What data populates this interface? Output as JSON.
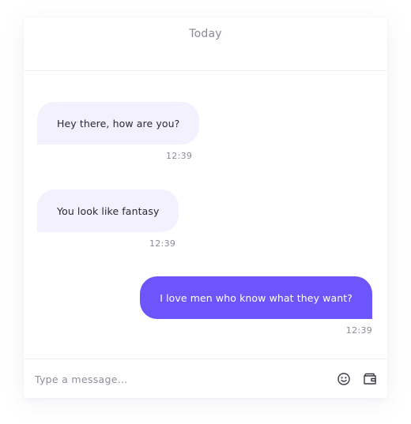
{
  "header": {
    "day_label": "Today"
  },
  "messages": [
    {
      "direction": "incoming",
      "text": "Hey there, how are you?",
      "time": "12:39"
    },
    {
      "direction": "incoming",
      "text": "You look like fantasy",
      "time": "12:39"
    },
    {
      "direction": "outgoing",
      "text": "I love men who know what they want?",
      "time": "12:39"
    }
  ],
  "composer": {
    "placeholder": "Type a message...",
    "value": "",
    "emoji_icon": "smiley-icon",
    "wallet_icon": "wallet-icon"
  },
  "colors": {
    "accent": "#6b55fb",
    "incoming_bubble": "#f3f1fe",
    "muted_text": "#8a8a96"
  }
}
